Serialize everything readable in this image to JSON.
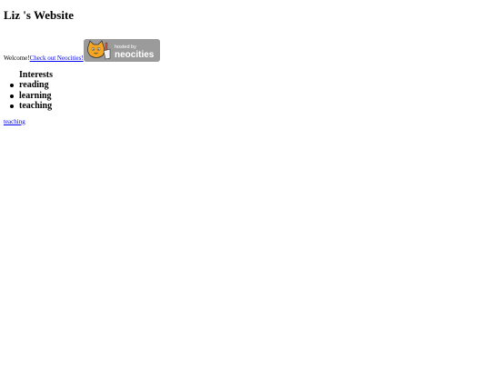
{
  "header": {
    "title": "Liz 's Website"
  },
  "welcome": {
    "text": "Welcome!",
    "link": " Check out Neocities!"
  },
  "badge": {
    "alt": "hosted by neocities",
    "icon": "neocities-cat-logo"
  },
  "interests": {
    "heading": "Interests",
    "items": [
      "reading",
      "learning",
      "teaching"
    ]
  },
  "footer_link": "teaching"
}
